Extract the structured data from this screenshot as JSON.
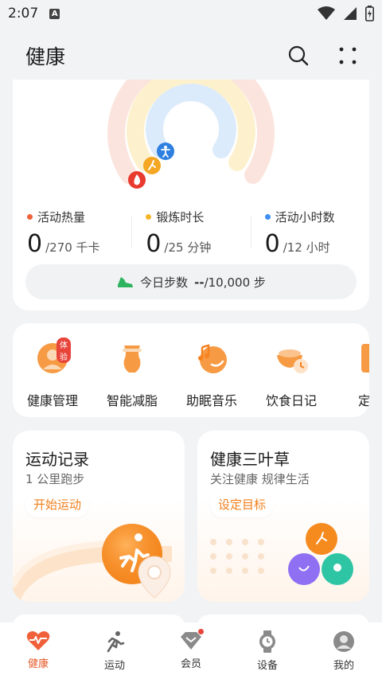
{
  "status_bar": {
    "time": "2:07",
    "notif_icon_letter": "A"
  },
  "header": {
    "title": "健康"
  },
  "activity": {
    "metrics": [
      {
        "label": "活动热量",
        "value": "0",
        "unit": "/270 千卡",
        "color": "#f0613a"
      },
      {
        "label": "锻炼时长",
        "value": "0",
        "unit": "/25 分钟",
        "color": "#f7b62a"
      },
      {
        "label": "活动小时数",
        "value": "0",
        "unit": "/12 小时",
        "color": "#3d8ff0"
      }
    ],
    "steps": {
      "label": "今日步数",
      "value": "--",
      "goal": "/10,000 步"
    }
  },
  "services": [
    {
      "label": "健康管理",
      "badge": "体验",
      "icon": "health-management-icon"
    },
    {
      "label": "智能减脂",
      "icon": "smart-fat-loss-icon"
    },
    {
      "label": "助眠音乐",
      "icon": "sleep-music-icon"
    },
    {
      "label": "饮食日记",
      "icon": "diet-diary-icon"
    },
    {
      "label": "定制",
      "icon": "custom-plan-icon"
    }
  ],
  "feature_cards": {
    "exercise": {
      "title": "运动记录",
      "subtitle": "1 公里跑步",
      "button": "开始运动"
    },
    "clover": {
      "title": "健康三叶草",
      "subtitle": "关注健康 规律生活",
      "button": "设定目标"
    }
  },
  "nav": [
    {
      "label": "健康",
      "icon": "health-heart-icon",
      "active": true
    },
    {
      "label": "运动",
      "icon": "running-person-icon"
    },
    {
      "label": "会员",
      "icon": "member-diamond-icon",
      "dot": true
    },
    {
      "label": "设备",
      "icon": "watch-icon"
    },
    {
      "label": "我的",
      "icon": "profile-avatar-icon"
    }
  ],
  "colors": {
    "accent": "#f07f1c",
    "calorie": "#f0613a",
    "exercise": "#f7b62a",
    "activity": "#3d8ff0"
  }
}
